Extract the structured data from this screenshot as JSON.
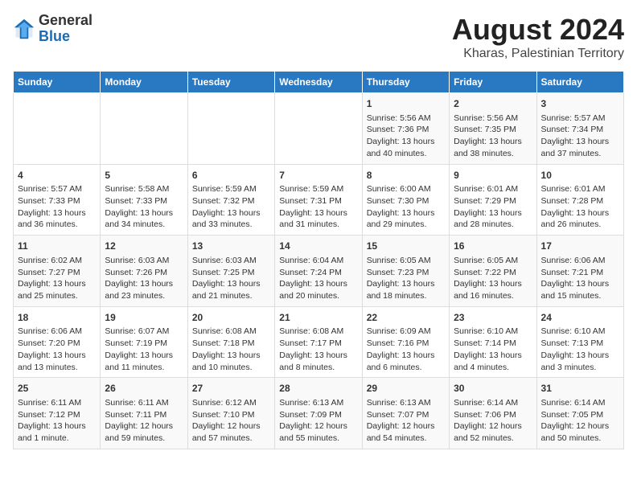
{
  "logo": {
    "general": "General",
    "blue": "Blue"
  },
  "header": {
    "title": "August 2024",
    "subtitle": "Kharas, Palestinian Territory"
  },
  "days_of_week": [
    "Sunday",
    "Monday",
    "Tuesday",
    "Wednesday",
    "Thursday",
    "Friday",
    "Saturday"
  ],
  "weeks": [
    [
      {
        "day": "",
        "info": ""
      },
      {
        "day": "",
        "info": ""
      },
      {
        "day": "",
        "info": ""
      },
      {
        "day": "",
        "info": ""
      },
      {
        "day": "1",
        "info": "Sunrise: 5:56 AM\nSunset: 7:36 PM\nDaylight: 13 hours\nand 40 minutes."
      },
      {
        "day": "2",
        "info": "Sunrise: 5:56 AM\nSunset: 7:35 PM\nDaylight: 13 hours\nand 38 minutes."
      },
      {
        "day": "3",
        "info": "Sunrise: 5:57 AM\nSunset: 7:34 PM\nDaylight: 13 hours\nand 37 minutes."
      }
    ],
    [
      {
        "day": "4",
        "info": "Sunrise: 5:57 AM\nSunset: 7:33 PM\nDaylight: 13 hours\nand 36 minutes."
      },
      {
        "day": "5",
        "info": "Sunrise: 5:58 AM\nSunset: 7:33 PM\nDaylight: 13 hours\nand 34 minutes."
      },
      {
        "day": "6",
        "info": "Sunrise: 5:59 AM\nSunset: 7:32 PM\nDaylight: 13 hours\nand 33 minutes."
      },
      {
        "day": "7",
        "info": "Sunrise: 5:59 AM\nSunset: 7:31 PM\nDaylight: 13 hours\nand 31 minutes."
      },
      {
        "day": "8",
        "info": "Sunrise: 6:00 AM\nSunset: 7:30 PM\nDaylight: 13 hours\nand 29 minutes."
      },
      {
        "day": "9",
        "info": "Sunrise: 6:01 AM\nSunset: 7:29 PM\nDaylight: 13 hours\nand 28 minutes."
      },
      {
        "day": "10",
        "info": "Sunrise: 6:01 AM\nSunset: 7:28 PM\nDaylight: 13 hours\nand 26 minutes."
      }
    ],
    [
      {
        "day": "11",
        "info": "Sunrise: 6:02 AM\nSunset: 7:27 PM\nDaylight: 13 hours\nand 25 minutes."
      },
      {
        "day": "12",
        "info": "Sunrise: 6:03 AM\nSunset: 7:26 PM\nDaylight: 13 hours\nand 23 minutes."
      },
      {
        "day": "13",
        "info": "Sunrise: 6:03 AM\nSunset: 7:25 PM\nDaylight: 13 hours\nand 21 minutes."
      },
      {
        "day": "14",
        "info": "Sunrise: 6:04 AM\nSunset: 7:24 PM\nDaylight: 13 hours\nand 20 minutes."
      },
      {
        "day": "15",
        "info": "Sunrise: 6:05 AM\nSunset: 7:23 PM\nDaylight: 13 hours\nand 18 minutes."
      },
      {
        "day": "16",
        "info": "Sunrise: 6:05 AM\nSunset: 7:22 PM\nDaylight: 13 hours\nand 16 minutes."
      },
      {
        "day": "17",
        "info": "Sunrise: 6:06 AM\nSunset: 7:21 PM\nDaylight: 13 hours\nand 15 minutes."
      }
    ],
    [
      {
        "day": "18",
        "info": "Sunrise: 6:06 AM\nSunset: 7:20 PM\nDaylight: 13 hours\nand 13 minutes."
      },
      {
        "day": "19",
        "info": "Sunrise: 6:07 AM\nSunset: 7:19 PM\nDaylight: 13 hours\nand 11 minutes."
      },
      {
        "day": "20",
        "info": "Sunrise: 6:08 AM\nSunset: 7:18 PM\nDaylight: 13 hours\nand 10 minutes."
      },
      {
        "day": "21",
        "info": "Sunrise: 6:08 AM\nSunset: 7:17 PM\nDaylight: 13 hours\nand 8 minutes."
      },
      {
        "day": "22",
        "info": "Sunrise: 6:09 AM\nSunset: 7:16 PM\nDaylight: 13 hours\nand 6 minutes."
      },
      {
        "day": "23",
        "info": "Sunrise: 6:10 AM\nSunset: 7:14 PM\nDaylight: 13 hours\nand 4 minutes."
      },
      {
        "day": "24",
        "info": "Sunrise: 6:10 AM\nSunset: 7:13 PM\nDaylight: 13 hours\nand 3 minutes."
      }
    ],
    [
      {
        "day": "25",
        "info": "Sunrise: 6:11 AM\nSunset: 7:12 PM\nDaylight: 13 hours\nand 1 minute."
      },
      {
        "day": "26",
        "info": "Sunrise: 6:11 AM\nSunset: 7:11 PM\nDaylight: 12 hours\nand 59 minutes."
      },
      {
        "day": "27",
        "info": "Sunrise: 6:12 AM\nSunset: 7:10 PM\nDaylight: 12 hours\nand 57 minutes."
      },
      {
        "day": "28",
        "info": "Sunrise: 6:13 AM\nSunset: 7:09 PM\nDaylight: 12 hours\nand 55 minutes."
      },
      {
        "day": "29",
        "info": "Sunrise: 6:13 AM\nSunset: 7:07 PM\nDaylight: 12 hours\nand 54 minutes."
      },
      {
        "day": "30",
        "info": "Sunrise: 6:14 AM\nSunset: 7:06 PM\nDaylight: 12 hours\nand 52 minutes."
      },
      {
        "day": "31",
        "info": "Sunrise: 6:14 AM\nSunset: 7:05 PM\nDaylight: 12 hours\nand 50 minutes."
      }
    ]
  ]
}
